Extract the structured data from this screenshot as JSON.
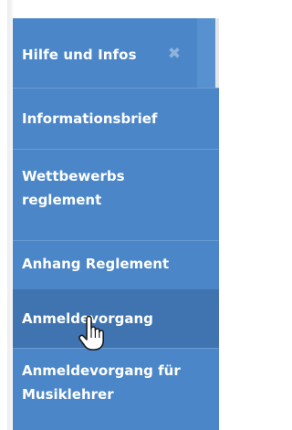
{
  "menu": {
    "header": {
      "title": "Hilfe und Infos",
      "close_icon": "✖"
    },
    "items": [
      {
        "label": "Informationsbrief",
        "active": false
      },
      {
        "label": "Wettbewerbs reglement",
        "active": false
      },
      {
        "label": "Anhang Reglement",
        "active": false
      },
      {
        "label": "Anmeldevorgang",
        "active": true
      },
      {
        "label": "Anmeldevorgang für Musiklehrer",
        "active": false
      }
    ]
  },
  "colors": {
    "menu_bg": "#4a86c8",
    "active_item_bg": "#3f74b0",
    "text": "#ffffff"
  },
  "icons": {
    "close": "close-icon",
    "cursor": "hand-pointer-icon"
  }
}
